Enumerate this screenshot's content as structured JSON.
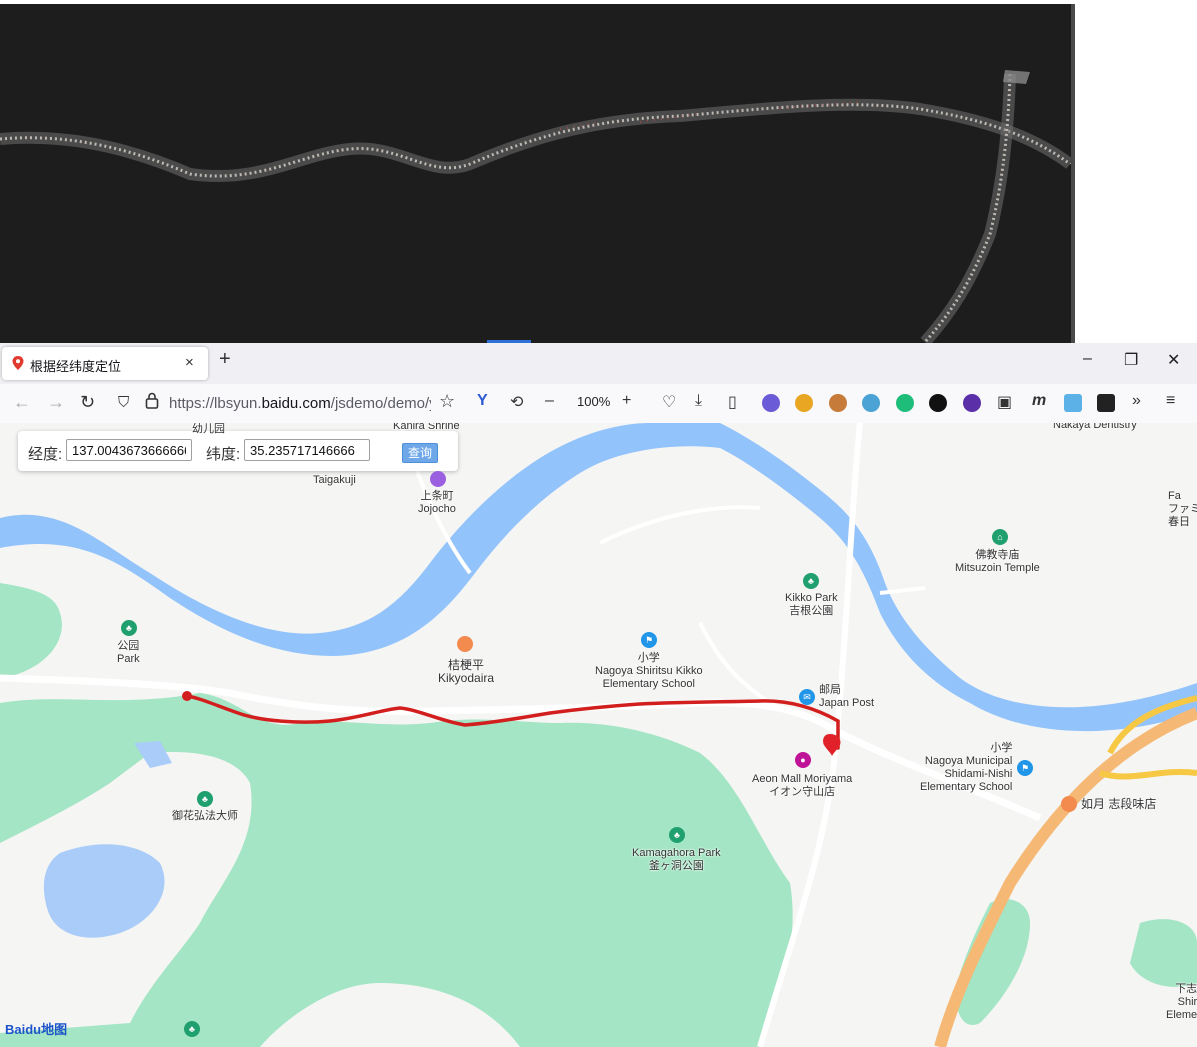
{
  "browser": {
    "tab_title": "根据经纬度定位",
    "tab_close": "×",
    "new_tab": "+",
    "window_controls": {
      "minimize": "–",
      "restore": "❐",
      "close": "✕"
    },
    "url": {
      "prefix": "https://lbsyun.",
      "domain": "baidu.com",
      "path": "/jsdemo/demo/yi"
    },
    "zoom": "100%",
    "toolbar_icons": [
      "back-arrow-icon",
      "forward-arrow-icon",
      "reload-icon",
      "shield-icon",
      "lock-icon",
      "star-icon",
      "extension-v-icon",
      "history-icon",
      "zoom-out-icon",
      "zoom-in-icon",
      "pocket-icon",
      "download-icon",
      "reader-view-icon",
      "account-icon",
      "extension-icons",
      "overflow-icon",
      "menu-icon"
    ]
  },
  "search": {
    "lng_label": "经度:",
    "lng_value": "137.0043673666666",
    "lat_label": "纬度:",
    "lat_value": "35.235717146666",
    "query_button": "查询"
  },
  "map": {
    "labels": {
      "kanira": "Kanira Shrine",
      "top_cut": "幼儿园",
      "taigakuji": "Taigakuji",
      "jojocho_zh": "上条町",
      "jojocho_en": "Jojocho",
      "nakaya": "Nakaya Dentistry",
      "fami_1": "Fa",
      "fami_2": "ファミ",
      "fami_3": "春日",
      "temple_zh": "佛教寺庙",
      "temple_en": "Mitsuzoin Temple",
      "kikko_en": "Kikko Park",
      "kikko_zh": "吉根公園",
      "park_zh": "公园",
      "park_en": "Park",
      "kikyo_zh": "桔梗平",
      "kikyo_en": "Kikyodaira",
      "school_zh": "小学",
      "school_en_1": "Nagoya Shiritsu Kikko",
      "school_en_2": "Elementary School",
      "post_zh": "邮局",
      "post_en": "Japan Post",
      "aeon_en": "Aeon Mall Moriyama",
      "aeon_ja": "イオン守山店",
      "shidami_zh": "小学",
      "shidami_1": "Nagoya Municipal",
      "shidami_2": "Shidami-Nishi",
      "shidami_3": "Elementary School",
      "kisaragi": "如月 志段味店",
      "gokake": "御花弘法大师",
      "kamaga_en": "Kamagahora Park",
      "kamaga_ja": "釜ヶ洞公園",
      "right_cut_1": "下志",
      "right_cut_2": "Shir",
      "right_cut_3": "Eleme"
    },
    "logo": {
      "bai": "Bai",
      "du": "du",
      "map": "地图"
    }
  }
}
